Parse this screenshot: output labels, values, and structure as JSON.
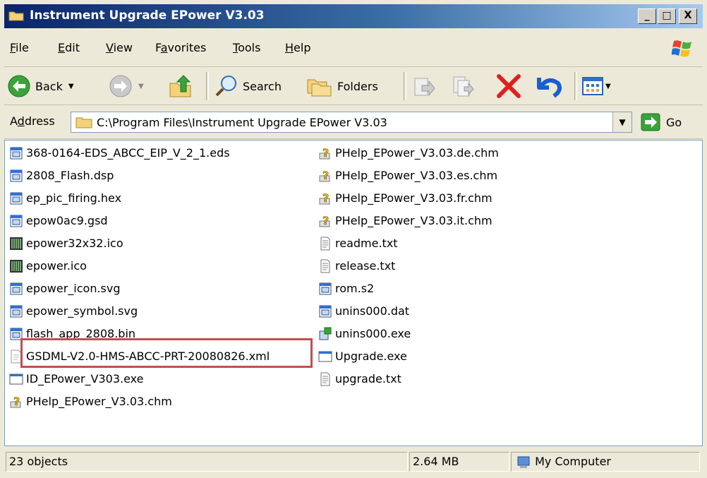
{
  "window": {
    "title": "Instrument Upgrade EPower V3.03"
  },
  "caption_buttons": {
    "minimize": "_",
    "maximize": "□",
    "close": "X"
  },
  "menu": [
    {
      "label": "File",
      "u": "F",
      "rest": "ile"
    },
    {
      "label": "Edit",
      "u": "E",
      "rest": "dit"
    },
    {
      "label": "View",
      "u": "V",
      "rest": "iew"
    },
    {
      "label": "Favorites",
      "pre": "F",
      "u": "a",
      "rest": "vorites"
    },
    {
      "label": "Tools",
      "u": "T",
      "rest": "ools"
    },
    {
      "label": "Help",
      "u": "H",
      "rest": "elp"
    }
  ],
  "toolbar": {
    "back": "Back",
    "search": "Search",
    "folders": "Folders"
  },
  "address": {
    "label_pre": "A",
    "label_u": "d",
    "label_rest": "dress",
    "path": "C:\\Program Files\\Instrument Upgrade EPower V3.03",
    "go": "Go"
  },
  "files_left": [
    {
      "name": "368-0164-EDS_ABCC_EIP_V_2_1.eds",
      "icon": "generic-file-icon"
    },
    {
      "name": "2808_Flash.dsp",
      "icon": "generic-file-icon"
    },
    {
      "name": "ep_pic_firing.hex",
      "icon": "generic-file-icon"
    },
    {
      "name": "epow0ac9.gsd",
      "icon": "generic-file-icon"
    },
    {
      "name": "epower32x32.ico",
      "icon": "icon-file-icon"
    },
    {
      "name": "epower.ico",
      "icon": "icon-file-icon"
    },
    {
      "name": "epower_icon.svg",
      "icon": "generic-file-icon"
    },
    {
      "name": "epower_symbol.svg",
      "icon": "generic-file-icon"
    },
    {
      "name": "flash_app_2808.bin",
      "icon": "generic-file-icon"
    },
    {
      "name": "GSDML-V2.0-HMS-ABCC-PRT-20080826.xml",
      "icon": "xml-file-icon"
    },
    {
      "name": "ID_EPower_V303.exe",
      "icon": "exe-file-icon"
    },
    {
      "name": "PHelp_EPower_V3.03.chm",
      "icon": "help-file-icon"
    }
  ],
  "files_right": [
    {
      "name": "PHelp_EPower_V3.03.de.chm",
      "icon": "help-file-icon"
    },
    {
      "name": "PHelp_EPower_V3.03.es.chm",
      "icon": "help-file-icon"
    },
    {
      "name": "PHelp_EPower_V3.03.fr.chm",
      "icon": "help-file-icon"
    },
    {
      "name": "PHelp_EPower_V3.03.it.chm",
      "icon": "help-file-icon"
    },
    {
      "name": "readme.txt",
      "icon": "text-file-icon"
    },
    {
      "name": "release.txt",
      "icon": "text-file-icon"
    },
    {
      "name": "rom.s2",
      "icon": "generic-file-icon"
    },
    {
      "name": "unins000.dat",
      "icon": "generic-file-icon"
    },
    {
      "name": "unins000.exe",
      "icon": "uninstall-icon"
    },
    {
      "name": "Upgrade.exe",
      "icon": "exe-file-icon"
    },
    {
      "name": "upgrade.txt",
      "icon": "text-file-icon"
    }
  ],
  "status": {
    "count": "23 objects",
    "size": "2.64 MB",
    "zone": "My Computer"
  },
  "colors": {
    "title_start": "#0a246a",
    "title_end": "#a6caf0",
    "highlight": "#c0504d",
    "chrome": "#ece9d8"
  }
}
